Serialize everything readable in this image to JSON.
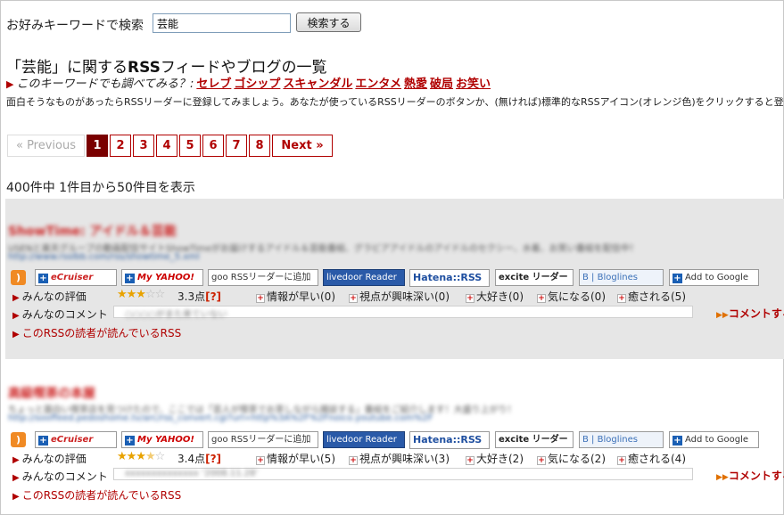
{
  "search": {
    "label": "お好みキーワードで検索",
    "value": "芸能",
    "button": "検索する"
  },
  "title": {
    "quote_open": "「",
    "keyword": "芸能",
    "mid": "」に関する",
    "rss": "RSS",
    "rest": "フィードやブログの一覧"
  },
  "related": {
    "lead": "このキーワードでも調べてみる？:",
    "links": [
      "セレブ",
      "ゴシップ",
      "スキャンダル",
      "エンタメ",
      "熱愛",
      "破局",
      "お笑い"
    ]
  },
  "intro": "面白そうなものがあったらRSSリーダーに登録してみましょう。あなたが使っているRSSリーダーのボタンか、(無ければ)標準的なRSSアイコン(オレンジ色)をクリックすると登録できます。",
  "pager": {
    "prev": "« Previous",
    "pages": [
      "1",
      "2",
      "3",
      "4",
      "5",
      "6",
      "7",
      "8"
    ],
    "current": "1",
    "next": "Next »"
  },
  "count_text": "400件中 1件目から50件目を表示",
  "readers_buttons": {
    "rss": "RSS",
    "ecruiser": "eCruiser",
    "yahoo": "My YAHOO!",
    "goo": "goo RSSリーダーに追加",
    "livedoor": "livedoor Reader",
    "hatena": "Hatena::RSS",
    "excite": "excite リーダー",
    "bloglines": "B | Bloglines",
    "google": "Add to Google"
  },
  "labels": {
    "rating": "みんなの評価",
    "comments": "みんなのコメント",
    "comment_link": "コメントする",
    "readers": "このRSSの読者が読んでいるRSS",
    "question": "[?]"
  },
  "feeds": [
    {
      "title": "ShowTime: アイドル＆芸能",
      "desc": "USENと楽天グループの動画配信サイトShowTimeがお届けするアイドル＆芸能番組、グラビアアイドルのアイドルのセクシー、水着、お笑い番組を配信中！",
      "url": "http://www.rsslbb.com/rss/showtime_5.xml",
      "stars": 3,
      "score": "3.3点",
      "tags": [
        "情報が早い(0)",
        "視点が興味深い(0)",
        "大好き(0)",
        "気になる(0)",
        "癒される(5)"
      ],
      "comment_preview": "○○○○がまた来ていない"
    },
    {
      "title": "高級喫茶の本屋",
      "desc": "ちょっと面白い喫茶店を見つけたので、ここでは「芸人が喫茶でお茶しながら雑談する」番組をご紹介します！大盛り上がり！",
      "url": "http://sooffeed.pedoshome.tv/arc/rss_convert.cgi?url=http%3A%2F%2Fnoico.youtube.com%2F",
      "stars": 3.5,
      "score": "3.4点",
      "tags": [
        "情報が早い(5)",
        "視点が興味深い(3)",
        "大好き(2)",
        "気になる(2)",
        "癒される(4)"
      ],
      "comment_preview": "xxxxxxxxxxxxxx ‘2008.11.28’"
    }
  ]
}
